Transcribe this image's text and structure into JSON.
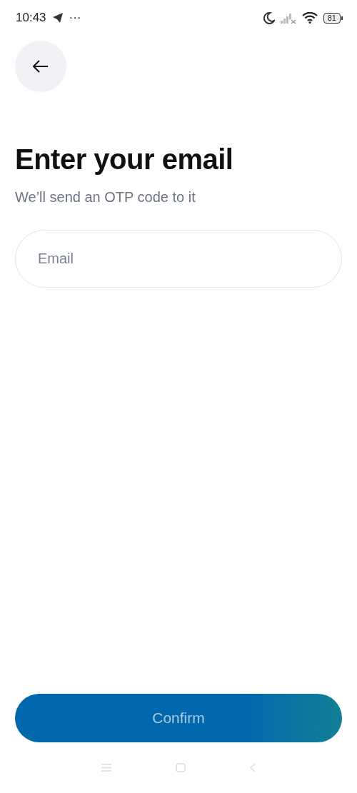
{
  "status_bar": {
    "time": "10:43",
    "more": "···",
    "battery": "81"
  },
  "header": {
    "title": "Enter your email",
    "subtitle": "We’ll send an OTP code to it"
  },
  "email_field": {
    "placeholder": "Email"
  },
  "confirm_button": {
    "label": "Confirm",
    "disabled": true
  }
}
